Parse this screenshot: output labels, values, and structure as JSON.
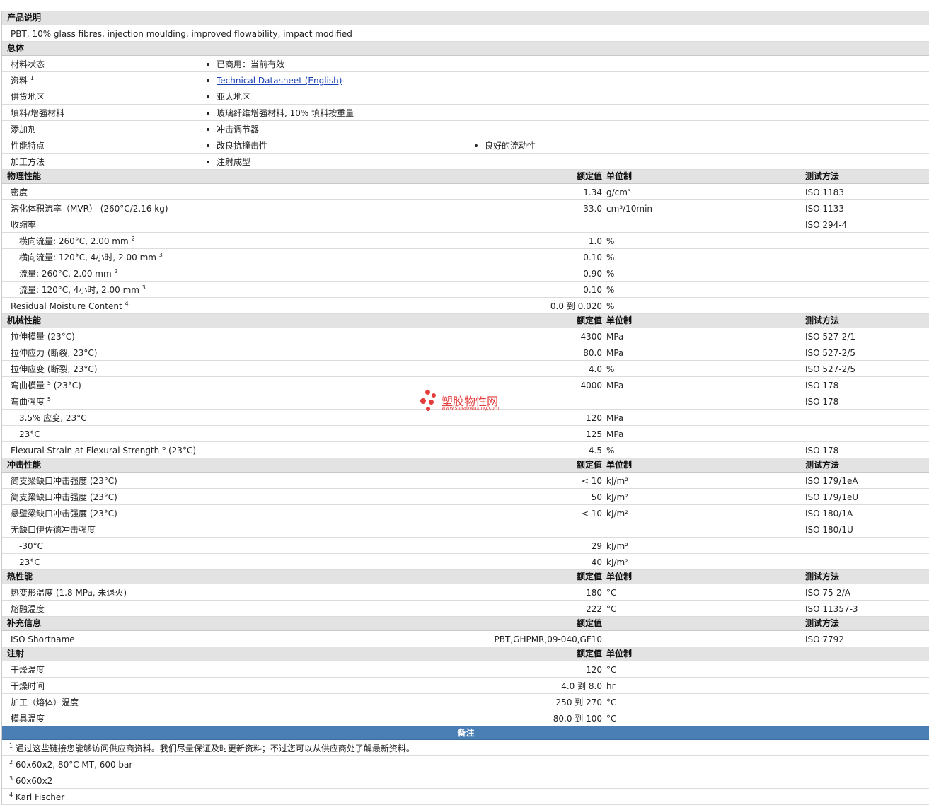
{
  "headers": {
    "value": "额定值",
    "unit": "单位制",
    "method": "测试方法"
  },
  "sections": [
    {
      "title": "产品说明",
      "type": "text",
      "rows": [
        {
          "text": "PBT, 10% glass fibres, injection moulding, improved flowability, impact modified"
        }
      ]
    },
    {
      "title": "总体",
      "type": "general",
      "rows": [
        {
          "label": "材料状态",
          "items": [
            "已商用：当前有效"
          ]
        },
        {
          "label": "资料",
          "sup": "1",
          "items": [
            "Technical Datasheet (English)"
          ],
          "link": true
        },
        {
          "label": "供货地区",
          "items": [
            "亚太地区"
          ]
        },
        {
          "label": "填料/增强材料",
          "items": [
            "玻璃纤维增强材料, 10% 填料按重量"
          ]
        },
        {
          "label": "添加剂",
          "items": [
            "冲击调节器"
          ]
        },
        {
          "label": "性能特点",
          "items": [
            "改良抗撞击性",
            "良好的流动性"
          ]
        },
        {
          "label": "加工方法",
          "items": [
            "注射成型"
          ]
        }
      ]
    },
    {
      "title": "物理性能",
      "type": "props",
      "cols": [
        "value",
        "unit",
        "method"
      ],
      "rows": [
        {
          "label": "密度",
          "value": "1.34",
          "unit": "g/cm³",
          "method": "ISO 1183"
        },
        {
          "label": "溶化体积流率（MVR） (260°C/2.16 kg)",
          "value": "33.0",
          "unit": "cm³/10min",
          "method": "ISO 1133"
        },
        {
          "label": "收缩率",
          "value": "",
          "unit": "",
          "method": "ISO 294-4"
        },
        {
          "label": "横向流量: 260°C, 2.00 mm",
          "sup": "2",
          "indent": true,
          "value": "1.0",
          "unit": "%",
          "method": ""
        },
        {
          "label": "横向流量: 120°C, 4小时, 2.00 mm",
          "sup": "3",
          "indent": true,
          "value": "0.10",
          "unit": "%",
          "method": ""
        },
        {
          "label": "流量: 260°C, 2.00 mm",
          "sup": "2",
          "indent": true,
          "value": "0.90",
          "unit": "%",
          "method": ""
        },
        {
          "label": "流量: 120°C, 4小时, 2.00 mm",
          "sup": "3",
          "indent": true,
          "value": "0.10",
          "unit": "%",
          "method": ""
        },
        {
          "label": "Residual Moisture Content",
          "sup": "4",
          "value": "0.0 到  0.020",
          "unit": "%",
          "method": ""
        }
      ]
    },
    {
      "title": "机械性能",
      "type": "props",
      "cols": [
        "value",
        "unit",
        "method"
      ],
      "rows": [
        {
          "label": "拉伸模量 (23°C)",
          "value": "4300",
          "unit": "MPa",
          "method": "ISO 527-2/1"
        },
        {
          "label": "拉伸应力 (断裂, 23°C)",
          "value": "80.0",
          "unit": "MPa",
          "method": "ISO 527-2/5"
        },
        {
          "label": "拉伸应变 (断裂, 23°C)",
          "value": "4.0",
          "unit": "%",
          "method": "ISO 527-2/5"
        },
        {
          "label": "弯曲模量",
          "sup": "5",
          "suffix": " (23°C)",
          "value": "4000",
          "unit": "MPa",
          "method": "ISO 178"
        },
        {
          "label": "弯曲强度",
          "sup": "5",
          "value": "",
          "unit": "",
          "method": "ISO 178"
        },
        {
          "label": "3.5% 应变, 23°C",
          "indent": true,
          "value": "120",
          "unit": "MPa",
          "method": ""
        },
        {
          "label": "23°C",
          "indent": true,
          "value": "125",
          "unit": "MPa",
          "method": ""
        },
        {
          "label": "Flexural Strain at Flexural Strength",
          "sup": "6",
          "suffix": " (23°C)",
          "value": "4.5",
          "unit": "%",
          "method": "ISO 178"
        }
      ]
    },
    {
      "title": "冲击性能",
      "type": "props",
      "cols": [
        "value",
        "unit",
        "method"
      ],
      "rows": [
        {
          "label": "简支梁缺口冲击强度 (23°C)",
          "value": "< 10",
          "unit": "kJ/m²",
          "method": "ISO 179/1eA"
        },
        {
          "label": "简支梁缺口冲击强度 (23°C)",
          "value": "50",
          "unit": "kJ/m²",
          "method": "ISO 179/1eU"
        },
        {
          "label": "悬壁梁缺口冲击强度 (23°C)",
          "value": "< 10",
          "unit": "kJ/m²",
          "method": "ISO 180/1A"
        },
        {
          "label": "无缺口伊佐德冲击强度",
          "value": "",
          "unit": "",
          "method": "ISO 180/1U"
        },
        {
          "label": "-30°C",
          "indent": true,
          "value": "29",
          "unit": "kJ/m²",
          "method": ""
        },
        {
          "label": "23°C",
          "indent": true,
          "value": "40",
          "unit": "kJ/m²",
          "method": ""
        }
      ]
    },
    {
      "title": "热性能",
      "type": "props",
      "cols": [
        "value",
        "unit",
        "method"
      ],
      "rows": [
        {
          "label": "热变形温度 (1.8 MPa, 未退火)",
          "value": "180",
          "unit": "°C",
          "method": "ISO 75-2/A"
        },
        {
          "label": "熔融温度",
          "value": "222",
          "unit": "°C",
          "method": "ISO 11357-3"
        }
      ]
    },
    {
      "title": "补充信息",
      "type": "props",
      "cols": [
        "value",
        "method"
      ],
      "rows": [
        {
          "label": "ISO Shortname",
          "value": "PBT,GHPMR,09-040,GF10",
          "unit": "",
          "method": "ISO 7792"
        }
      ]
    },
    {
      "title": "注射",
      "type": "props",
      "cols": [
        "value",
        "unit"
      ],
      "rows": [
        {
          "label": "干燥温度",
          "value": "120",
          "unit": "°C",
          "method": ""
        },
        {
          "label": "干燥时间",
          "value": "4.0 到  8.0",
          "unit": "hr",
          "method": ""
        },
        {
          "label": "加工（熔体）温度",
          "value": "250 到  270",
          "unit": "°C",
          "method": ""
        },
        {
          "label": "模具温度",
          "value": "80.0 到  100",
          "unit": "°C",
          "method": ""
        }
      ]
    }
  ],
  "notes": {
    "title": "备注",
    "items": [
      {
        "num": "1",
        "text": "通过这些链接您能够访问供应商资料。我们尽量保证及时更新资料；不过您可以从供应商处了解最新资料。"
      },
      {
        "num": "2",
        "text": "60x60x2, 80°C MT, 600 bar"
      },
      {
        "num": "3",
        "text": "60x60x2"
      },
      {
        "num": "4",
        "text": "Karl Fischer"
      }
    ]
  },
  "watermark": {
    "text": "塑胶物性网",
    "url": "www.sujiaowuxing.com",
    "color": "#e43d3d"
  }
}
